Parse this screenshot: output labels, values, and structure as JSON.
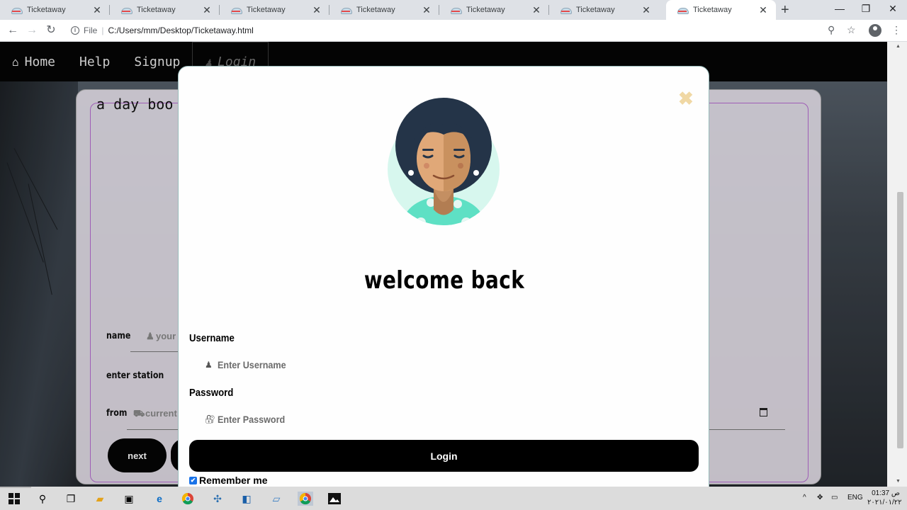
{
  "browser": {
    "tabs": [
      {
        "title": "Ticketaway",
        "active": false
      },
      {
        "title": "Ticketaway",
        "active": false
      },
      {
        "title": "Ticketaway",
        "active": false
      },
      {
        "title": "Ticketaway",
        "active": false
      },
      {
        "title": "Ticketaway",
        "active": false
      },
      {
        "title": "Ticketaway",
        "active": false
      },
      {
        "title": "Ticketaway",
        "active": true
      }
    ],
    "new_tab_icon": "+",
    "address": {
      "scheme": "File",
      "path": "C:/Users/mm/Desktop/Ticketaway.html"
    }
  },
  "site": {
    "nav": {
      "home": "Home",
      "help": "Help",
      "signup": "Signup",
      "login": "Login"
    },
    "card": {
      "tagline": "a day boo",
      "name_label": "name",
      "name_placeholder": "your",
      "station_label": "enter station",
      "from_label": "from",
      "from_placeholder": "current",
      "next_button": "next"
    }
  },
  "modal": {
    "close_icon": "✖",
    "title": "welcome back",
    "username_label": "Username",
    "username_placeholder": "Enter Username",
    "password_label": "Password",
    "password_placeholder": "Enter Password",
    "login_button": "Login",
    "remember_label": "Remember me",
    "remember_checked": true
  },
  "taskbar": {
    "language": "ENG",
    "time": "01:37 ص",
    "date": "٢٠٢١/٠١/٢٢"
  },
  "colors": {
    "accent": "#1a73e8",
    "modal_close": "#f0d8a4",
    "card_border": "#b46ad0",
    "avatar_hair": "#243448",
    "avatar_bg": "#d7f7ee"
  }
}
